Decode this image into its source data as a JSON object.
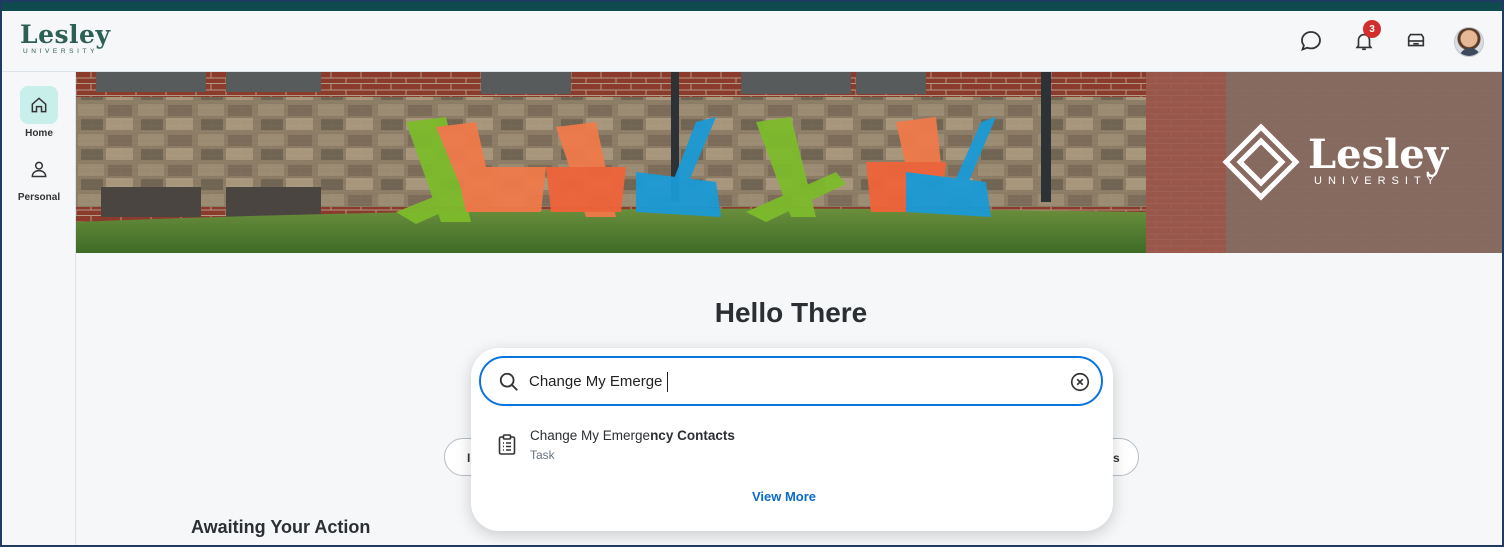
{
  "header": {
    "logo_word": "Lesley",
    "logo_sub": "UNIVERSITY",
    "notification_count": "3",
    "icons": [
      "chat-icon",
      "bell-icon",
      "inbox-icon",
      "avatar"
    ]
  },
  "sidebar": {
    "items": [
      {
        "label": "Home",
        "icon": "home-icon",
        "active": true
      },
      {
        "label": "Personal",
        "icon": "person-icon",
        "active": false
      }
    ]
  },
  "banner": {
    "brand_word": "Lesley",
    "brand_sub": "UNIVERSITY"
  },
  "main": {
    "greeting": "Hello There",
    "section_title": "Awaiting Your Action",
    "pill_left_fragment": "I",
    "pill_right_fragment": "s"
  },
  "search": {
    "query": "Change My Emerge",
    "results": [
      {
        "title_match": "Change My Emerge",
        "title_rest": "ncy Contacts",
        "type": "Task",
        "icon": "task-icon"
      }
    ],
    "view_more_label": "View More"
  },
  "colors": {
    "brand_green": "#2e5f55",
    "top_stripe": "#0f4a4f",
    "focus_blue": "#0875e1",
    "link_blue": "#0b6bcb",
    "badge_red": "#d32e2e",
    "active_nav_bg": "#c9efea"
  }
}
